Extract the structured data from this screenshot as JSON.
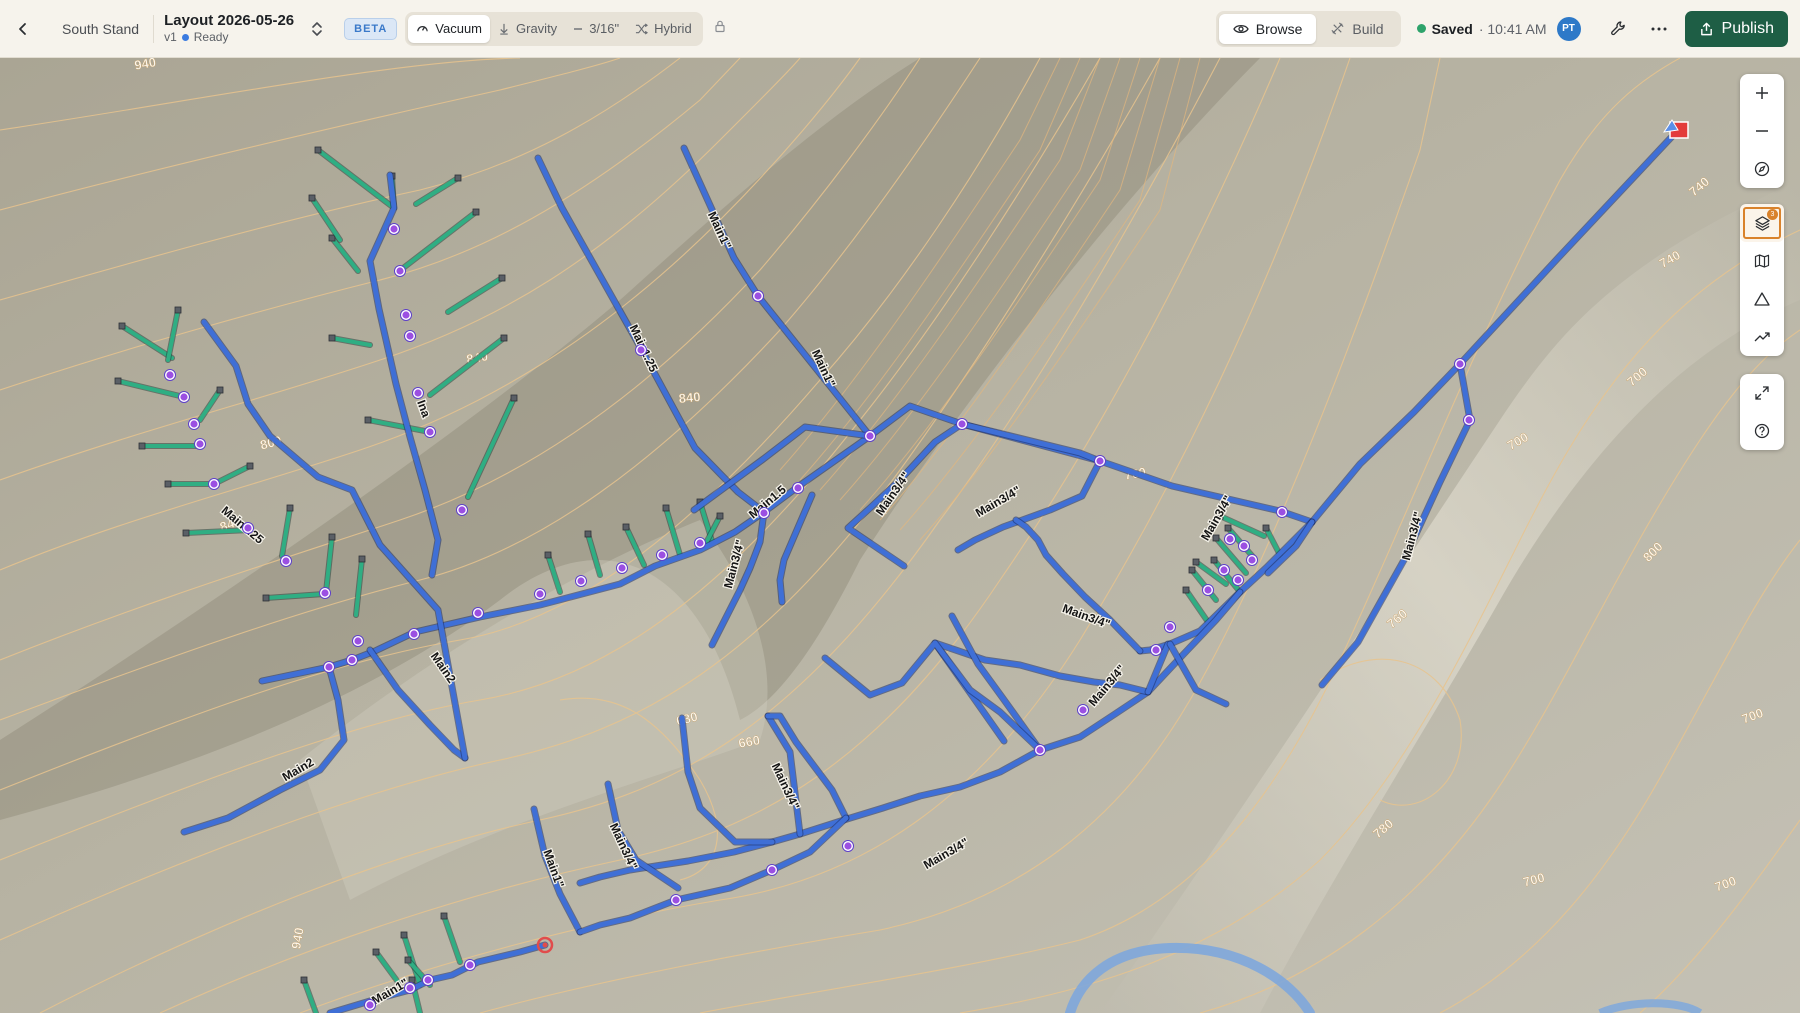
{
  "header": {
    "breadcrumb": "South Stand",
    "layout_title": "Layout 2026-05-26",
    "version": "v1",
    "status": "Ready",
    "beta_badge": "BETA",
    "modes": [
      {
        "label": "Vacuum",
        "icon": "gauge-icon",
        "active": true
      },
      {
        "label": "Gravity",
        "icon": "arrow-down-icon",
        "active": false
      },
      {
        "label": "3/16\"",
        "icon": "line-icon",
        "active": false
      },
      {
        "label": "Hybrid",
        "icon": "shuffle-icon",
        "active": false
      }
    ],
    "view_tabs": [
      {
        "label": "Browse",
        "icon": "eye-icon",
        "active": true
      },
      {
        "label": "Build",
        "icon": "tools-icon",
        "active": false
      }
    ],
    "saved_label": "Saved",
    "saved_time": "· 10:41 AM",
    "avatar_initials": "PT",
    "publish_label": "Publish"
  },
  "map_tools": {
    "layers_badge": "3"
  },
  "map": {
    "contour_labels": [
      "940",
      "840",
      "800",
      "840",
      "840",
      "740",
      "740",
      "760",
      "700",
      "800",
      "760",
      "700",
      "780",
      "700",
      "700",
      "660",
      "940",
      "680",
      "700"
    ],
    "line_labels": [
      "Main1\"",
      "Main1\"",
      "Main1.25",
      "Main1.25",
      "Ina",
      "Main1.5",
      "Main3/4\"",
      "Main3/4\"",
      "Main3/4\"",
      "Main3/4\"",
      "Main3/4\"",
      "Main3/4\"",
      "Main2",
      "Main2",
      "Main3/4\"",
      "Main3/4\"",
      "Main3/4\"",
      "Main1\"",
      "Main1\"",
      "Main3/4\""
    ]
  },
  "colors": {
    "main_line": "#3f6fd6",
    "lateral_line": "#2fae83",
    "contour": "#e8c48e",
    "stream": "#7aa6de",
    "publish": "#1e5e45"
  }
}
